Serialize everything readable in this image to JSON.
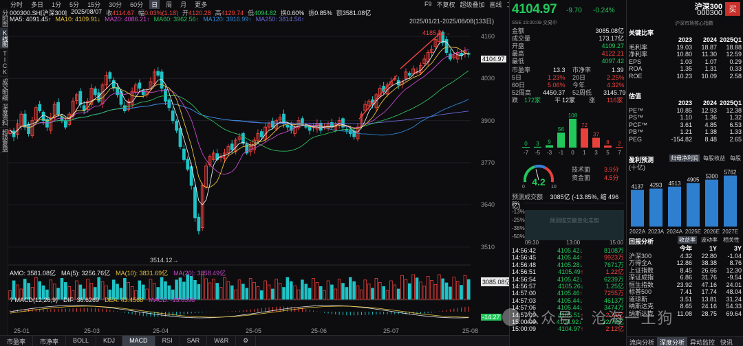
{
  "topbar": {
    "tabs": [
      "分时",
      "多日",
      "1分",
      "5分",
      "15分",
      "30分",
      "60分",
      "日",
      "周",
      "月",
      "更多"
    ],
    "active_index": 7,
    "right": [
      "F9",
      "不复权",
      "超级叠加",
      "画线",
      "工具"
    ]
  },
  "left_tabs": [
    "分时图",
    "K线图",
    "TICK",
    "成交明细",
    "深度资料",
    "超级复盘"
  ],
  "left_active_index": 1,
  "info": {
    "code": "000300.SH[沪深300]",
    "date": "2025/08/07",
    "close_label": "收",
    "close": "4114.67",
    "range_label": "幅",
    "range": "0.03%(1.18)",
    "open_label": "开",
    "open": "4120.28",
    "high_label": "高",
    "high": "4129.74",
    "low_label": "低",
    "low": "4094.82",
    "turnover_label": "换",
    "turnover": "0.60%",
    "amp_label": "振",
    "amp": "0.85%",
    "amount_label": "额",
    "amount": "3581.08亿"
  },
  "ma": {
    "ma5": "MA5: 4091.45↑",
    "ma10": "MA10: 4109.91↓",
    "ma20": "MA20: 4086.21↑",
    "ma60": "MA60: 3962.56↑",
    "ma120": "MA120: 3916.99↑",
    "ma250": "MA250: 3814.56↑"
  },
  "range_text": "2025/01/21-2025/08/08(133日)",
  "price_axis": [
    "4160",
    "4030",
    "3900",
    "3770",
    "3640",
    "3510"
  ],
  "current_tag": "4104.97",
  "high_annot": "4185.21→",
  "low_annot": "3514.12→",
  "amo": {
    "label": "AMO: 3581.08亿",
    "ma5": "MA(5): 3256.76亿",
    "ma10": "MA(10): 3831.69亿",
    "ma20": "MA(20): 3858.49亿",
    "tag": "3085.08亿"
  },
  "macd": {
    "label": "? MACD(12,26,9)",
    "dif": "DIF: 36.6269",
    "dea": "DEA: 43.4568",
    "macd": "MACD: -13.6598",
    "tag": "-14.27"
  },
  "x_axis": [
    "25-01",
    "25-03",
    "25-04",
    "25-05",
    "25-06",
    "25-07",
    "25-08"
  ],
  "bottom_tabs": [
    "市盈率",
    "市净率",
    "BOLL",
    "KDJ",
    "MACD",
    "RSI",
    "SAR",
    "W&R",
    "⚙"
  ],
  "bottom_active_index": 4,
  "quote": {
    "price": "4104.97",
    "change": "-9.70",
    "pct": "-0.24%",
    "sse": "SSE  15:00:09  交易中",
    "amount_label": "金额",
    "amount": "3085.08亿",
    "volume_label": "成交量",
    "volume": "173.17亿",
    "open_label": "开盘",
    "open": "4109.27",
    "high_label": "最高",
    "high": "4122.21",
    "low_label": "最低",
    "low": "4097.42",
    "pe_label": "市盈率",
    "pe": "13.3",
    "pb_label": "市净率",
    "pb": "1.39",
    "d5_label": "5日",
    "d5": "1.23%",
    "d20_label": "20日",
    "d20": "2.25%",
    "d60_label": "60日",
    "d60": "5.06%",
    "ytd_label": "今年",
    "ytd": "4.32%",
    "w52h_label": "52周高",
    "w52h": "4450.37",
    "w52l_label": "52周低",
    "w52l": "3145.79",
    "down_label": "跌",
    "down": "172家",
    "flat_label": "平",
    "flat": "12家",
    "up_label": "涨",
    "up": "116家"
  },
  "dist_chart": {
    "categories": [
      "-7",
      "-5",
      "-3",
      "-1",
      "0",
      "1",
      "3",
      "5",
      "7"
    ],
    "values": [
      0,
      3,
      9,
      56,
      108,
      72,
      37,
      8,
      2
    ],
    "colors": [
      "#23c85b",
      "#23c85b",
      "#23c85b",
      "#23c85b",
      "#23c85b",
      "#e8413b",
      "#e8413b",
      "#e8413b",
      "#e8413b"
    ]
  },
  "gauge": {
    "value": "4.2",
    "level": 0.42,
    "min": "0",
    "max": "10",
    "tech_label": "技术面",
    "tech": "3.9分",
    "fund_label": "资金面",
    "fund": "4.5分"
  },
  "forecast": {
    "title": "预测成交额",
    "amount": "3085亿",
    "detail": "(-13.85%, 缩 496亿)",
    "y_labels": [
      "0%",
      "-13%",
      "-25%",
      "-38%",
      "-50%"
    ],
    "x_labels": [
      "09:30",
      "13:00",
      "15:00"
    ],
    "placeholder": "预测成交额变化走势"
  },
  "ticks": [
    {
      "time": "14:56:42",
      "price": "4105.42",
      "dir": "↓",
      "vol": "8108万"
    },
    {
      "time": "14:56:45",
      "price": "4105.44",
      "dir": "↑",
      "vol": "9923万"
    },
    {
      "time": "14:56:48",
      "price": "4105.28",
      "dir": "↓",
      "vol": "7671万"
    },
    {
      "time": "14:56:51",
      "price": "4105.49",
      "dir": "↑",
      "vol": "1.22亿"
    },
    {
      "time": "14:56:54",
      "price": "4105.42",
      "dir": "↓",
      "vol": "6239万"
    },
    {
      "time": "14:56:57",
      "price": "4105.26",
      "dir": "↓",
      "vol": "1.25亿"
    },
    {
      "time": "14:57:00",
      "price": "4105.46",
      "dir": "↑",
      "vol": "7255万"
    },
    {
      "time": "14:57:03",
      "price": "4105.44",
      "dir": "↓",
      "vol": "4613万"
    },
    {
      "time": "14:57:06",
      "price": "4105.44",
      "dir": "↓",
      "vol": "3474万"
    },
    {
      "time": "14:57:09",
      "price": "4105.51",
      "dir": "↑",
      "vol": "2.21亿"
    },
    {
      "time": "15:00:09",
      "price": "4104.92",
      "dir": "↓",
      "vol": "22.72亿"
    },
    {
      "time": "15:00:09",
      "price": "4104.97",
      "dir": "↑",
      "vol": "2.12亿"
    }
  ],
  "right": {
    "name": "沪深300",
    "code": "000300",
    "buy": "买",
    "sub": "沪深市场核心指数",
    "key_title": "关键比率",
    "key_cols": [
      "2023",
      "2024",
      "2025Q1"
    ],
    "key_rows": [
      {
        "name": "毛利率",
        "v": [
          "19.03",
          "18.87",
          "18.88"
        ]
      },
      {
        "name": "净利率",
        "v": [
          "10.80",
          "11.30",
          "12.59"
        ]
      },
      {
        "name": "EPS",
        "v": [
          "1.03",
          "1.07",
          "0.29"
        ]
      },
      {
        "name": "ROA",
        "v": [
          "1.35",
          "1.31",
          "0.33"
        ]
      },
      {
        "name": "ROE",
        "v": [
          "10.23",
          "10.09",
          "2.58"
        ]
      }
    ],
    "val_title": "估值",
    "val_cols": [
      "2023",
      "2024",
      "2025Q1"
    ],
    "val_rows": [
      {
        "name": "PE™",
        "v": [
          "10.85",
          "12.93",
          "12.38"
        ]
      },
      {
        "name": "PS™",
        "v": [
          "1.10",
          "1.36",
          "1.32"
        ]
      },
      {
        "name": "PCF™",
        "v": [
          "3.61",
          "4.85",
          "6.53"
        ]
      },
      {
        "name": "PB™",
        "v": [
          "1.21",
          "1.38",
          "1.33"
        ]
      },
      {
        "name": "PEG",
        "v": [
          "-154.82",
          "8.48",
          "2.65"
        ]
      }
    ],
    "profit_title": "盈利预测",
    "profit_unit": "(十亿)",
    "profit_tabs": [
      "归母净利润",
      "每股收益",
      "每股"
    ],
    "profit_chart": {
      "type": "bar",
      "categories": [
        "2022A",
        "2023A",
        "2024A",
        "2025E",
        "2026E",
        "2027E"
      ],
      "values": [
        4137,
        4293,
        4513,
        4905,
        5300,
        5762
      ]
    },
    "ret_title": "回报分析",
    "ret_tabs": [
      "收益率",
      "波动率",
      "相关性"
    ],
    "ret_cols": [
      "今年",
      "1Y",
      "3Y"
    ],
    "ret_rows": [
      {
        "name": "沪深300",
        "v": [
          "4.32",
          "22.80",
          "-1.04"
        ]
      },
      {
        "name": "万得全A",
        "v": [
          "12.86",
          "38.38",
          "8.76"
        ]
      },
      {
        "name": "上证指数",
        "v": [
          "8.45",
          "26.66",
          "12.30"
        ]
      },
      {
        "name": "深证成指",
        "v": [
          "6.86",
          "31.76",
          "-9.54"
        ]
      },
      {
        "name": "恒生指数",
        "v": [
          "23.92",
          "47.16",
          "24.01"
        ]
      },
      {
        "name": "标普500",
        "v": [
          "7.41",
          "17.74",
          "48.04"
        ]
      },
      {
        "name": "道琼斯",
        "v": [
          "3.51",
          "13.81",
          "31.24"
        ]
      },
      {
        "name": "纳斯达克",
        "v": [
          "8.65",
          "24.16",
          "54.33"
        ]
      },
      {
        "name": "纳斯达克",
        "v": [
          "11.08",
          "28.75",
          "69.64"
        ]
      }
    ],
    "bottom_tabs": [
      "流向分析",
      "深度分析",
      "异动监控",
      "快讯"
    ],
    "bottom_active_index": 1
  },
  "watermark": "公众号 · 沧海一土狗",
  "chart_data": {
    "type": "candlestick",
    "title": "",
    "x_ticks": [
      "25-01",
      "25-03",
      "25-04",
      "25-05",
      "25-06",
      "25-07",
      "25-08"
    ],
    "y_ticks": [
      4160,
      4030,
      3900,
      3770,
      3640,
      3510
    ],
    "ylim": [
      3480,
      4200
    ],
    "high_marker": 4185.21,
    "low_marker": 3514.12,
    "last": 4104.97,
    "closes": [
      3870,
      3850,
      3890,
      3920,
      3880,
      3860,
      3900,
      3940,
      3930,
      3900,
      3880,
      3910,
      3950,
      3920,
      3900,
      3880,
      3920,
      3960,
      3980,
      3950,
      3930,
      3960,
      4000,
      3980,
      3960,
      4010,
      4040,
      4030,
      4000,
      3980,
      3950,
      3930,
      3960,
      3990,
      4010,
      4000,
      3980,
      3990,
      4020,
      4050,
      4040,
      4000,
      3960,
      3940,
      3900,
      3870,
      3820,
      3780,
      3750,
      3700,
      3600,
      3560,
      3700,
      3760,
      3790,
      3800,
      3780,
      3790,
      3800,
      3820,
      3810,
      3840,
      3850,
      3830,
      3800,
      3820,
      3840,
      3860,
      3850,
      3880,
      3890,
      3880,
      3900,
      3910,
      3890,
      3880,
      3870,
      3880,
      3900,
      3890,
      3880,
      3870,
      3880,
      3890,
      3870,
      3880,
      3890,
      3880,
      3890,
      3900,
      3880,
      3870,
      3860,
      3850,
      3880,
      3920,
      3950,
      3960,
      3950,
      3980,
      4000,
      3990,
      4010,
      4020,
      4030,
      4010,
      4020,
      4050,
      4040,
      4060,
      4050,
      4070,
      4090,
      4110,
      4120,
      4150,
      4170,
      4140,
      4110,
      4090,
      4100,
      4110,
      4100,
      4114.67,
      4104.97
    ],
    "ma_colors": {
      "ma5": "#e8e8e8",
      "ma10": "#e8c23a",
      "ma20": "#c848c8",
      "ma60": "#2fbf5a",
      "ma120": "#2f88d8",
      "ma250": "#6a6ad8"
    }
  }
}
